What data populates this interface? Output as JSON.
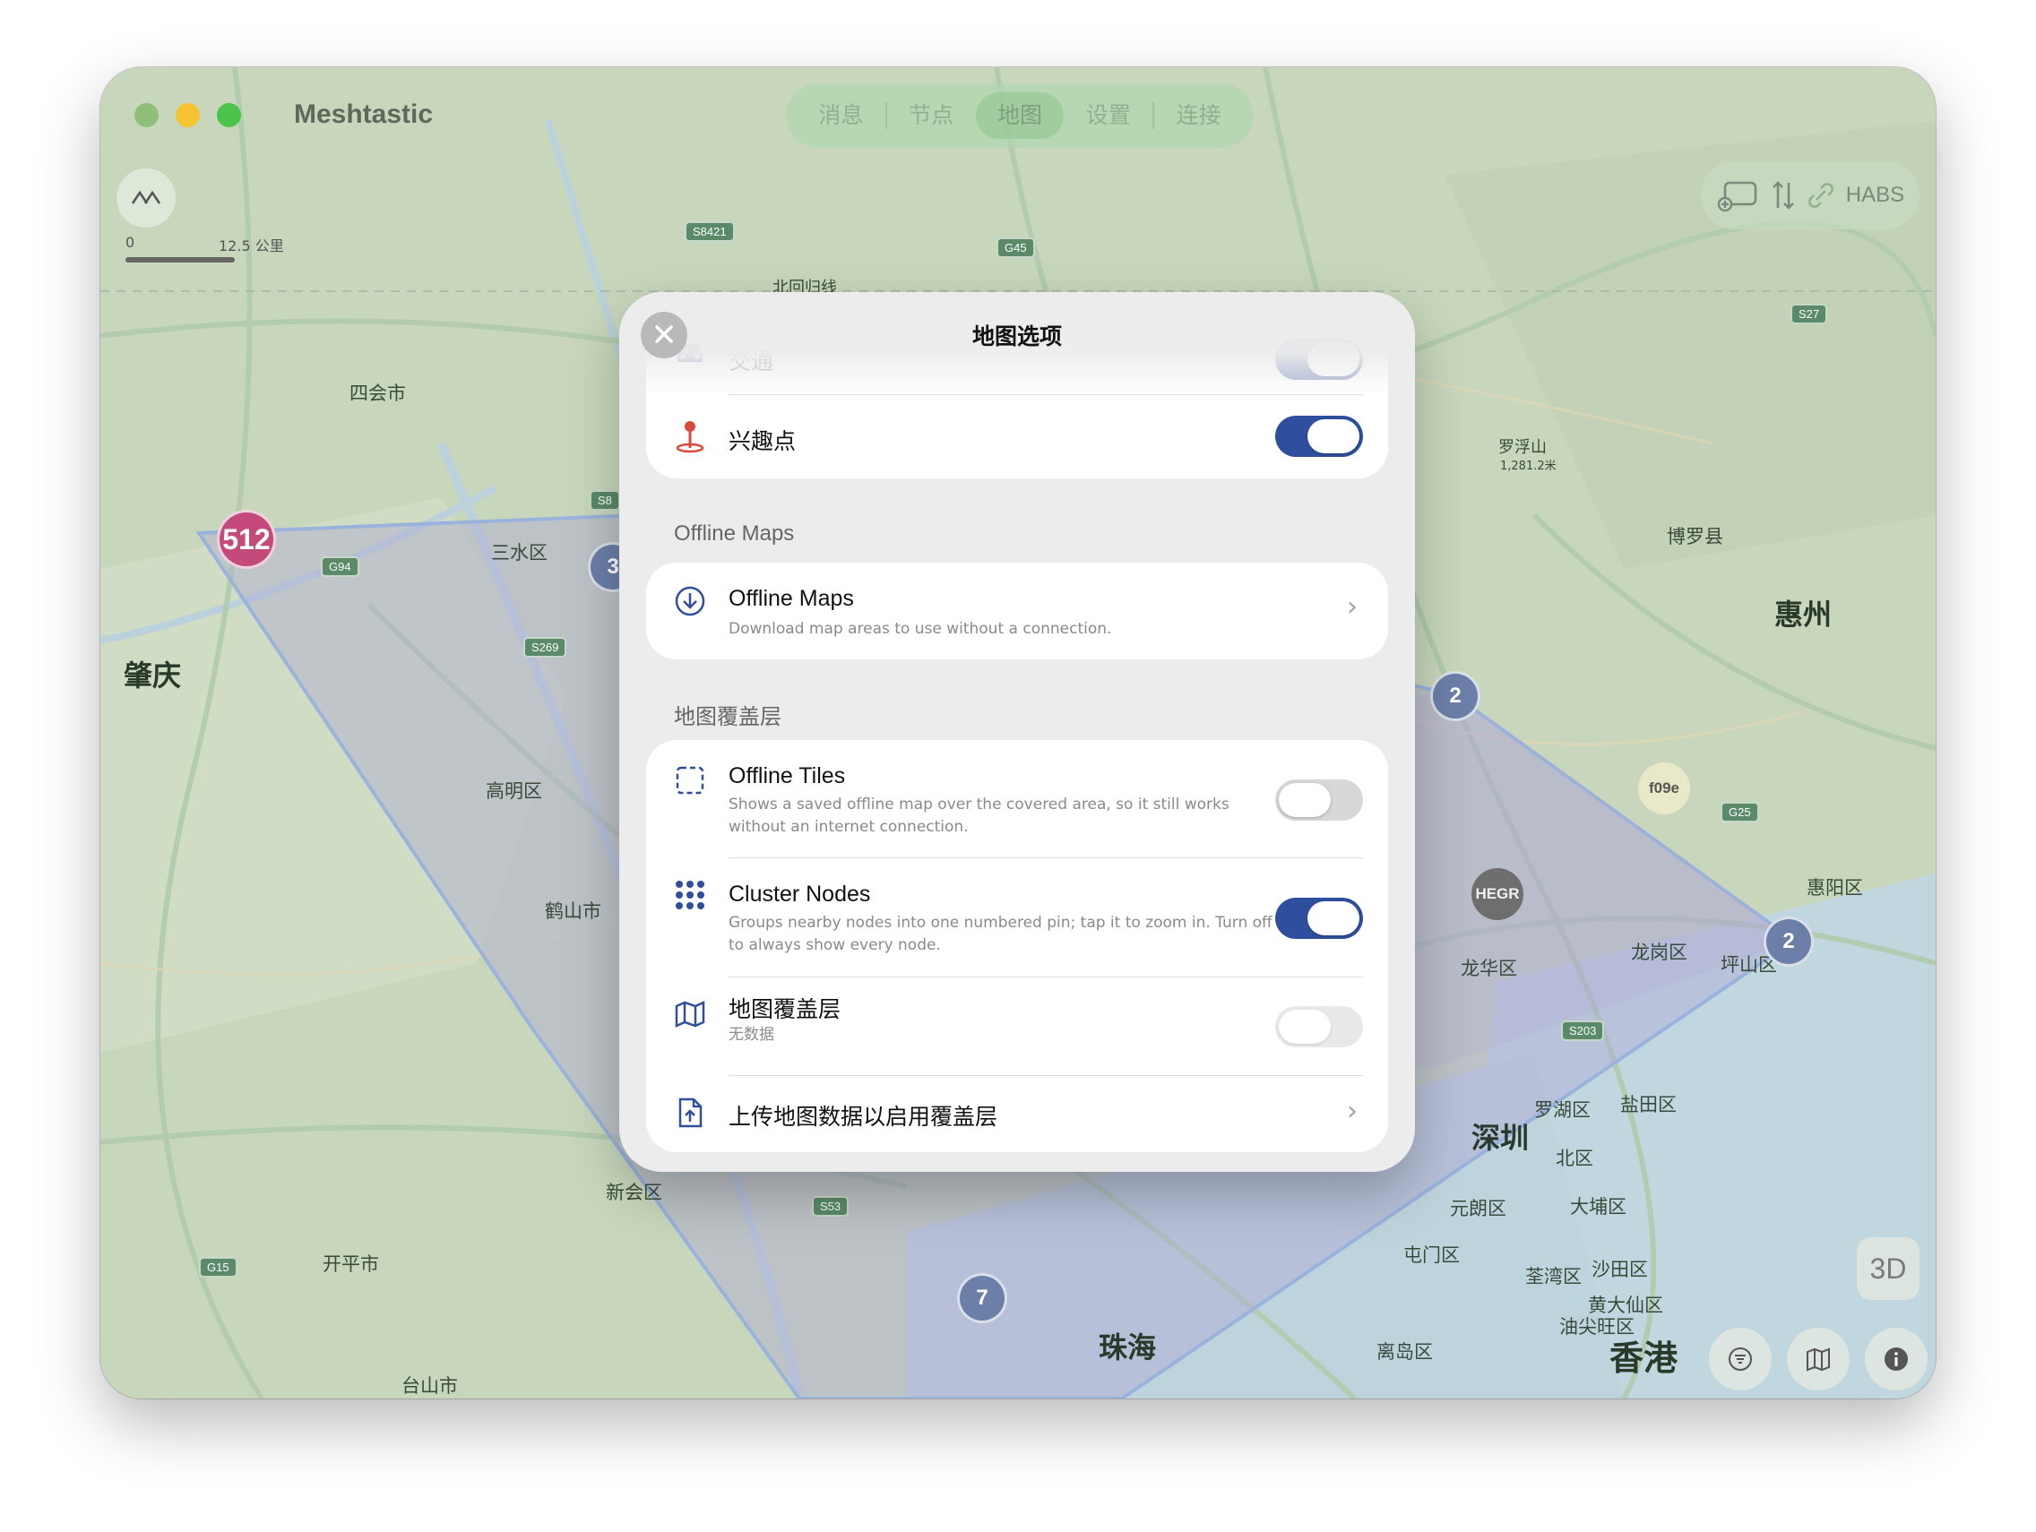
{
  "window": {
    "app_title": "Meshtastic",
    "tabs": [
      {
        "label": "消息",
        "active": false
      },
      {
        "label": "节点",
        "active": false
      },
      {
        "label": "地图",
        "active": true
      },
      {
        "label": "设置",
        "active": false
      },
      {
        "label": "连接",
        "active": false
      }
    ]
  },
  "map": {
    "scale": {
      "zero": "0",
      "distance": "12.5 公里"
    },
    "tools": {
      "device_label": "HABS"
    },
    "btn_3d": "3D",
    "places": [
      {
        "name": "四会市"
      },
      {
        "name": "肇庆"
      },
      {
        "name": "三水区"
      },
      {
        "name": "高明区"
      },
      {
        "name": "鹤山市"
      },
      {
        "name": "新会区"
      },
      {
        "name": "开平市"
      },
      {
        "name": "台山市"
      },
      {
        "name": "珠海"
      },
      {
        "name": "深圳"
      },
      {
        "name": "香港"
      },
      {
        "name": "惠州"
      },
      {
        "name": "博罗县"
      },
      {
        "name": "罗浮山"
      },
      {
        "name": "1,281.2米"
      },
      {
        "name": "惠阳区"
      },
      {
        "name": "龙岗区"
      },
      {
        "name": "坪山区"
      },
      {
        "name": "龙华区"
      },
      {
        "name": "罗湖区"
      },
      {
        "name": "盐田区"
      },
      {
        "name": "北区"
      },
      {
        "name": "元朗区"
      },
      {
        "name": "大埔区"
      },
      {
        "name": "屯门区"
      },
      {
        "name": "荃湾区"
      },
      {
        "name": "沙田区"
      },
      {
        "name": "黄大仙区"
      },
      {
        "name": "油尖旺区"
      },
      {
        "name": "离岛区"
      },
      {
        "name": "北回归线"
      }
    ],
    "roads": [
      "S8421",
      "G45",
      "S27",
      "S8",
      "G94",
      "S269",
      "G25",
      "S203",
      "S53",
      "G15"
    ],
    "clusters": [
      {
        "count": "512",
        "color": "#c34a7a"
      },
      {
        "count": "3",
        "color": "#6b7fa8"
      },
      {
        "count": "2",
        "color": "#6b7fa8"
      },
      {
        "count": "2",
        "color": "#6b7fa8"
      },
      {
        "count": "7",
        "color": "#6b7fa8"
      }
    ],
    "nodes": [
      {
        "short_name": "HEGR"
      },
      {
        "short_name": "f09e"
      }
    ],
    "colors": {
      "coverage_fill": "#8a7fc8",
      "toggle_on": "#2f4f9e"
    }
  },
  "modal": {
    "title": "地图选项",
    "top_card": {
      "traffic": {
        "label": "交通",
        "enabled": true
      },
      "poi": {
        "label": "兴趣点",
        "enabled": true
      }
    },
    "offline_section": {
      "header": "Offline Maps",
      "item": {
        "title": "Offline Maps",
        "subtitle": "Download map areas to use without a connection."
      }
    },
    "overlay_section": {
      "header": "地图覆盖层",
      "offline_tiles": {
        "title": "Offline Tiles",
        "subtitle": "Shows a saved offline map over the covered area, so it still works without an internet connection.",
        "enabled": false
      },
      "cluster_nodes": {
        "title": "Cluster Nodes",
        "subtitle": "Groups nearby nodes into one numbered pin; tap it to zoom in. Turn off to always show every node.",
        "enabled": true
      },
      "map_overlay": {
        "title": "地图覆盖层",
        "subtitle": "无数据",
        "enabled": false
      },
      "upload": {
        "title": "上传地图数据以启用覆盖层"
      }
    }
  }
}
